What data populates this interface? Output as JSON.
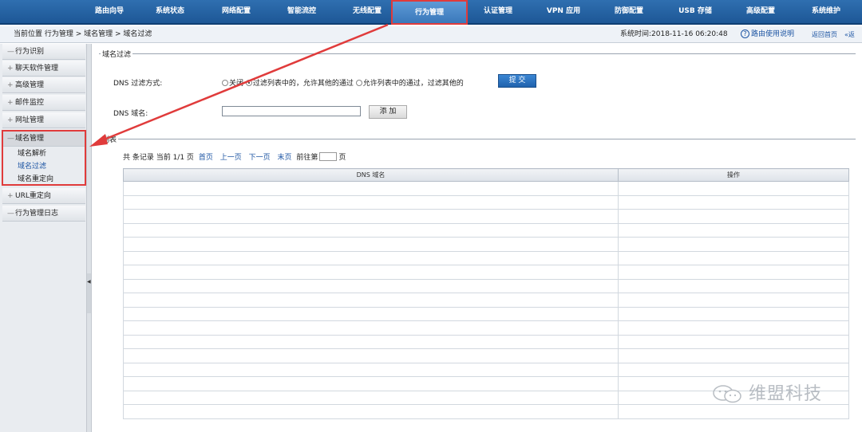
{
  "nav": {
    "items": [
      "路由向导",
      "系统状态",
      "网络配置",
      "智能流控",
      "无线配置",
      "行为管理",
      "认证管理",
      "VPN 应用",
      "防御配置",
      "USB 存储",
      "高级配置",
      "系统维护"
    ],
    "active_index": 5
  },
  "crumbbar": {
    "crumb": "当前位置 行为管理 > 域名管理 > 域名过滤",
    "systime": "系统时间:2018-11-16 06:20:48",
    "help": "路由使用说明",
    "home": "返回首页",
    "back": "返"
  },
  "sidebar": {
    "groups": [
      {
        "sign": "—",
        "label": "行为识别"
      },
      {
        "sign": "+",
        "label": "聊天软件管理"
      },
      {
        "sign": "+",
        "label": "高级管理"
      },
      {
        "sign": "+",
        "label": "邮件监控"
      },
      {
        "sign": "+",
        "label": "网址管理"
      },
      {
        "sign": "—",
        "label": "域名管理"
      },
      {
        "sign": "+",
        "label": "URL重定向"
      },
      {
        "sign": "—",
        "label": "行为管理日志"
      }
    ],
    "subitems": [
      "域名解析",
      "域名过滤",
      "域名重定向"
    ],
    "active_sub": 1
  },
  "filter": {
    "legend": "域名过滤",
    "mode_label": "DNS 过滤方式:",
    "options": [
      "关闭",
      "过滤列表中的，允许其他的通过",
      "允许列表中的通过，过滤其他的"
    ],
    "selected_option": 1,
    "submit": "提 交",
    "domain_label": "DNS 域名:",
    "domain_value": "",
    "add": "添 加"
  },
  "list": {
    "legend": "列表",
    "pager": {
      "summary": "共 条记录 当前 1/1 页",
      "first": "首页",
      "prev": "上一页",
      "next": "下一页",
      "last": "末页",
      "goto": "前往第",
      "page_unit": "页"
    },
    "columns": [
      "DNS 域名",
      "操作"
    ],
    "rows": []
  },
  "watermark": "维盟科技",
  "colors": {
    "nav_bg": "#1d5796",
    "highlight": "#e03b3b",
    "link": "#1d55a3"
  }
}
